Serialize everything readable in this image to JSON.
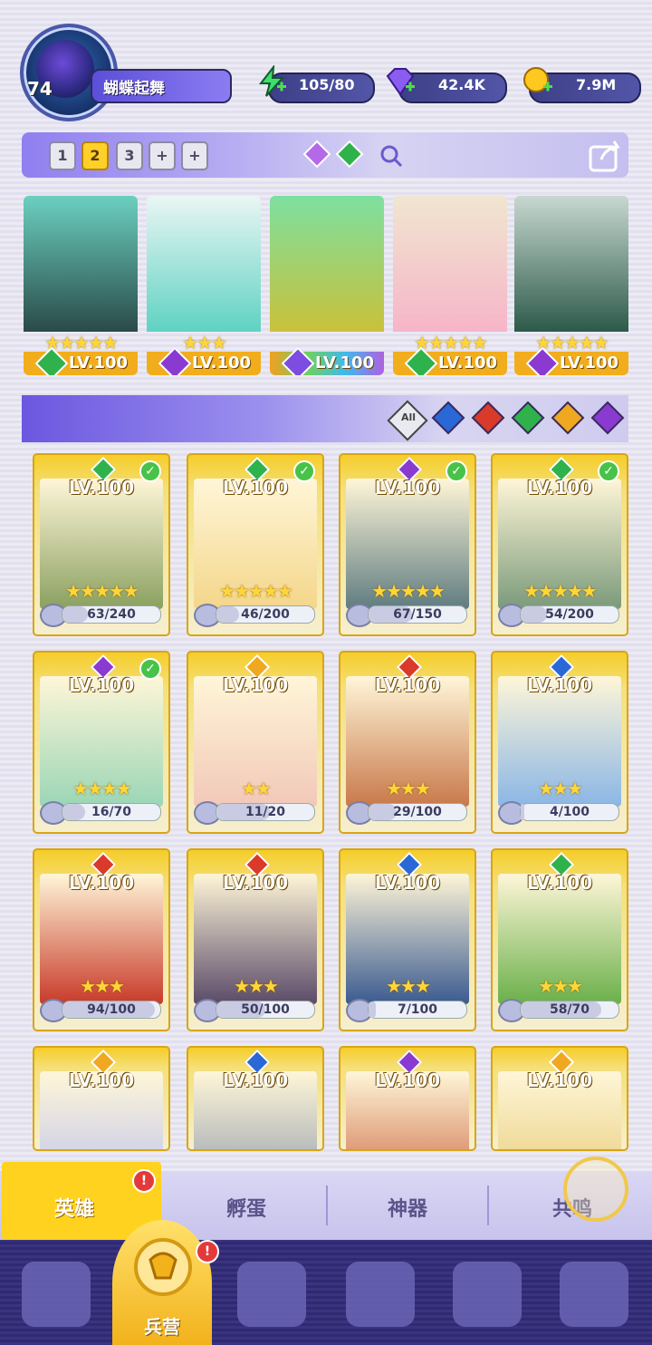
{
  "player": {
    "level": "74",
    "name": "蝴蝶起舞"
  },
  "resources": [
    {
      "icon": "energy-icon",
      "value": "105/80"
    },
    {
      "icon": "gem-icon",
      "value": "42.4K"
    },
    {
      "icon": "gold-coin-icon",
      "value": "7.9M"
    }
  ],
  "team_tabs": [
    "1",
    "2",
    "3",
    "+",
    "+"
  ],
  "team_cards": [
    {
      "level": "LV.100",
      "stars": "★★★★★",
      "element": "#2fb24b",
      "art": "#2a4a48"
    },
    {
      "level": "LV.100",
      "stars": "★★★",
      "element": "#8a3ad0",
      "art": "#5fd2c2"
    },
    {
      "level": "LV.100",
      "stars": "",
      "element": "#7c4de0",
      "art": "#c9c13a"
    },
    {
      "level": "LV.100",
      "stars": "★★★★★",
      "element": "#2fb24b",
      "art": "#f6b5c8"
    },
    {
      "level": "LV.100",
      "stars": "★★★★★",
      "element": "#8a3ad0",
      "art": "#2c5a4a"
    }
  ],
  "filter": {
    "all_label": "All",
    "elements": [
      "#2a68d8",
      "#d93a2a",
      "#2fb24b",
      "#f0a820",
      "#8a3ad0"
    ]
  },
  "heroes": [
    {
      "level": "LV.100",
      "progress": "63/240",
      "stars": "★★★★★",
      "gem": "#2fb24b",
      "checked": true,
      "art": "#8aa060"
    },
    {
      "level": "LV.100",
      "progress": "46/200",
      "stars": "★★★★★",
      "gem": "#2fb24b",
      "checked": true,
      "art": "#f4d68a"
    },
    {
      "level": "LV.100",
      "progress": "67/150",
      "stars": "★★★★★",
      "gem": "#8a3ad0",
      "checked": true,
      "art": "#5f7c80"
    },
    {
      "level": "LV.100",
      "progress": "54/200",
      "stars": "★★★★★",
      "gem": "#2fb24b",
      "checked": true,
      "art": "#7a9a7a"
    },
    {
      "level": "LV.100",
      "progress": "16/70",
      "stars": "★★★★",
      "gem": "#8a3ad0",
      "checked": true,
      "art": "#9ad6b6"
    },
    {
      "level": "LV.100",
      "progress": "11/20",
      "stars": "★★",
      "gem": "#f0a820",
      "checked": false,
      "art": "#f2c8b8"
    },
    {
      "level": "LV.100",
      "progress": "29/100",
      "stars": "★★★",
      "gem": "#d93a2a",
      "checked": false,
      "art": "#c8784a"
    },
    {
      "level": "LV.100",
      "progress": "4/100",
      "stars": "★★★",
      "gem": "#2a68d8",
      "checked": false,
      "art": "#8ab6e6"
    },
    {
      "level": "LV.100",
      "progress": "94/100",
      "stars": "★★★",
      "gem": "#d93a2a",
      "checked": false,
      "art": "#c83a2a"
    },
    {
      "level": "LV.100",
      "progress": "50/100",
      "stars": "★★★",
      "gem": "#d93a2a",
      "checked": false,
      "art": "#5a4a68"
    },
    {
      "level": "LV.100",
      "progress": "7/100",
      "stars": "★★★",
      "gem": "#2a68d8",
      "checked": false,
      "art": "#3a5a90"
    },
    {
      "level": "LV.100",
      "progress": "58/70",
      "stars": "★★★",
      "gem": "#2fb24b",
      "checked": false,
      "art": "#6ab04a"
    },
    {
      "level": "LV.100",
      "progress": "",
      "stars": "",
      "gem": "#f0a820",
      "checked": false,
      "art": "#b8c0f0"
    },
    {
      "level": "LV.100",
      "progress": "",
      "stars": "",
      "gem": "#2a68d8",
      "checked": false,
      "art": "#8a96a8"
    },
    {
      "level": "LV.100",
      "progress": "",
      "stars": "",
      "gem": "#8a3ad0",
      "checked": false,
      "art": "#c8603a"
    },
    {
      "level": "LV.100",
      "progress": "",
      "stars": "",
      "gem": "#f0a820",
      "checked": false,
      "art": "#e6c870"
    }
  ],
  "sub_tabs": [
    "英雄",
    "孵蛋",
    "神器",
    "共鸣"
  ],
  "bottom_nav": {
    "active_label": "兵营",
    "badge": "!"
  }
}
